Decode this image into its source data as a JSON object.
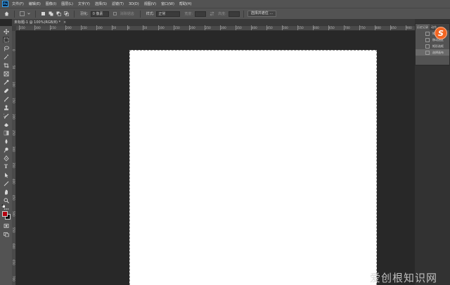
{
  "app": {
    "logo": "Ps",
    "menu": [
      "文件(F)",
      "编辑(E)",
      "图像(I)",
      "图层(L)",
      "文字(Y)",
      "选择(S)",
      "滤镜(T)",
      "3D(D)",
      "视图(V)",
      "窗口(W)",
      "帮助(H)"
    ]
  },
  "options": {
    "feather_label": "羽化:",
    "feather_value": "0 像素",
    "antialias_label": "消除锯齿",
    "style_label": "样式:",
    "style_value": "正常",
    "width_label": "宽度:",
    "height_label": "高度:",
    "select_mask_button": "选择并遮住 ..."
  },
  "document": {
    "tab_title": "未标题-1 @ 100%(RGB/8) *",
    "close": "×",
    "ruler_h": [
      "350",
      "300",
      "250",
      "200",
      "150",
      "100",
      "50",
      "0",
      "50",
      "100",
      "150",
      "200",
      "250",
      "300",
      "350",
      "400",
      "450",
      "500",
      "550",
      "600",
      "650",
      "700",
      "750",
      "800",
      "850",
      "900"
    ],
    "ruler_v": [
      "0",
      "50",
      "100",
      "150",
      "200",
      "250",
      "300",
      "350",
      "400",
      "450",
      "500",
      "550",
      "600",
      "650",
      "700"
    ]
  },
  "history_panel": {
    "tabs": [
      "历史记录",
      "动作"
    ],
    "items": [
      "矩形选框",
      "移动选区",
      "矩形选框",
      "选择画布"
    ],
    "selected_index": 3
  },
  "tools": [
    "move",
    "marquee",
    "lasso",
    "magic-wand",
    "crop",
    "frame",
    "eyedropper",
    "healing",
    "brush",
    "stamp",
    "history-brush",
    "eraser",
    "gradient",
    "blur",
    "dodge",
    "pen",
    "type",
    "path-select",
    "shape",
    "hand",
    "zoom",
    "more"
  ],
  "colors": {
    "foreground": "#b3000f",
    "background": "#111111",
    "accent": "#31a8ff",
    "watermark": "#f26522"
  },
  "watermark": {
    "badge": "S",
    "text": "爱创根知识网"
  }
}
